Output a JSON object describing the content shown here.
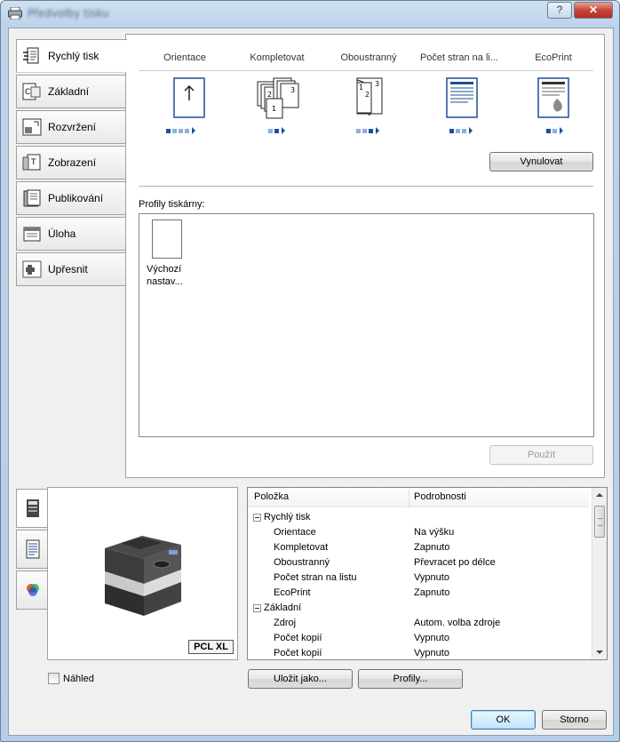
{
  "window": {
    "title": "Předvolby tisku",
    "help_label": "?",
    "close_label": "✕"
  },
  "left_tabs": [
    {
      "label": "Rychlý tisk",
      "icon": "quick-print-icon"
    },
    {
      "label": "Základní",
      "icon": "basic-icon"
    },
    {
      "label": "Rozvržení",
      "icon": "layout-icon"
    },
    {
      "label": "Zobrazení",
      "icon": "imaging-icon"
    },
    {
      "label": "Publikování",
      "icon": "publishing-icon"
    },
    {
      "label": "Úloha",
      "icon": "job-icon"
    },
    {
      "label": "Upřesnit",
      "icon": "advanced-icon"
    }
  ],
  "quick_print": {
    "columns": [
      {
        "label": "Orientace",
        "icon": "orientation-icon",
        "dots": 4,
        "active_dot": 0
      },
      {
        "label": "Kompletovat",
        "icon": "collate-icon",
        "dots": 2,
        "active_dot": 1
      },
      {
        "label": "Oboustranný",
        "icon": "duplex-icon",
        "dots": 3,
        "active_dot": 1
      },
      {
        "label": "Počet stran na li...",
        "icon": "pages-per-sheet-icon",
        "dots": 3,
        "active_dot": 0
      },
      {
        "label": "EcoPrint",
        "icon": "ecoprint-icon",
        "dots": 2,
        "active_dot": 0
      }
    ],
    "reset_label": "Vynulovat"
  },
  "profiles": {
    "label": "Profily tiskárny:",
    "items": [
      {
        "name": "Výchozí nastav..."
      }
    ],
    "apply_label": "Použít"
  },
  "preview": {
    "tabs": [
      "printer-view-icon",
      "page-view-icon",
      "color-view-icon"
    ],
    "badge": "PCL XL",
    "checkbox_label": "Náhled"
  },
  "details": {
    "headers": {
      "item": "Položka",
      "details": "Podrobnosti"
    },
    "rows": [
      {
        "key": "Rychlý tisk",
        "value": "",
        "group": true
      },
      {
        "key": "Orientace",
        "value": "Na výšku"
      },
      {
        "key": "Kompletovat",
        "value": "Zapnuto"
      },
      {
        "key": "Oboustranný",
        "value": "Převracet po délce"
      },
      {
        "key": "Počet stran na listu",
        "value": "Vypnuto"
      },
      {
        "key": "EcoPrint",
        "value": "Zapnuto"
      },
      {
        "key": "Základní",
        "value": "",
        "group": true
      },
      {
        "key": "Zdroj",
        "value": "Autom. volba zdroje"
      },
      {
        "key": "Počet kopií",
        "value": "Vypnuto"
      },
      {
        "key": "Počet kopií",
        "value": "Vypnuto"
      }
    ]
  },
  "buttons": {
    "save_as": "Uložit jako...",
    "profiles": "Profily...",
    "ok": "OK",
    "cancel": "Storno"
  }
}
